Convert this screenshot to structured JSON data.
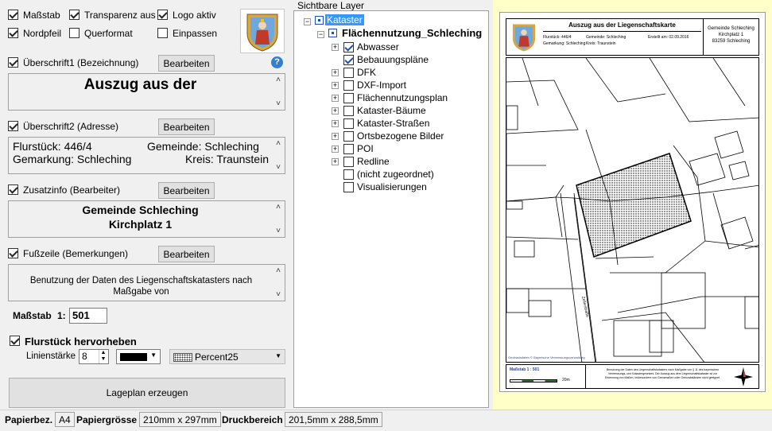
{
  "options": {
    "massstab": {
      "label": "Maßstab",
      "checked": true
    },
    "transparenz": {
      "label": "Transparenz aus",
      "checked": true
    },
    "logo": {
      "label": "Logo aktiv",
      "checked": true
    },
    "nordpfeil": {
      "label": "Nordpfeil",
      "checked": true
    },
    "querformat": {
      "label": "Querformat",
      "checked": false
    },
    "einpassen": {
      "label": "Einpassen",
      "checked": false
    }
  },
  "sections": {
    "ueberschrift1": {
      "label": "Überschrift1 (Bezeichnung)",
      "button": "Bearbeiten",
      "text": "Auszug aus der",
      "help": "?"
    },
    "ueberschrift2": {
      "label": "Überschrift2 (Adresse)",
      "button": "Bearbeiten",
      "flurstueck": "Flurstück: 446/4",
      "gemeinde": "Gemeinde: Schleching",
      "gemarkung": "Gemarkung: Schleching",
      "kreis": "Kreis: Traunstein"
    },
    "zusatzinfo": {
      "label": "Zusatzinfo (Bearbeiter)",
      "button": "Bearbeiten",
      "line1": "Gemeinde Schleching",
      "line2": "Kirchplatz 1"
    },
    "fusszeile": {
      "label": "Fußzeile (Bemerkungen)",
      "button": "Bearbeiten",
      "text": "Benutzung der Daten des Liegenschaftskatasters nach Maßgabe von"
    }
  },
  "scale": {
    "label": "Maßstab",
    "prefix": "1:",
    "value": "501"
  },
  "flurstueck": {
    "label": "Flurstück hervorheben",
    "checked": true,
    "linienstaerke_label": "Linienstärke",
    "linienstaerke_value": "8",
    "color": "#000000",
    "pattern": "Percent25"
  },
  "generate_button": "Lageplan erzeugen",
  "layers": {
    "title": "Sichtbare Layer",
    "root": "Kataster",
    "group": "Flächennutzung_Schleching",
    "items": [
      {
        "label": "Abwasser",
        "checked": true,
        "expand": true
      },
      {
        "label": "Bebauungspläne",
        "checked": true,
        "expand": false
      },
      {
        "label": "DFK",
        "checked": false,
        "expand": true
      },
      {
        "label": "DXF-Import",
        "checked": false,
        "expand": true
      },
      {
        "label": "Flächennutzungsplan",
        "checked": false,
        "expand": true
      },
      {
        "label": "Kataster-Bäume",
        "checked": false,
        "expand": true
      },
      {
        "label": "Kataster-Straßen",
        "checked": false,
        "expand": true
      },
      {
        "label": "Ortsbezogene Bilder",
        "checked": false,
        "expand": true
      },
      {
        "label": "POI",
        "checked": false,
        "expand": true
      },
      {
        "label": "Redline",
        "checked": false,
        "expand": true
      },
      {
        "label": "(nicht zugeordnet)",
        "checked": false,
        "expand": false
      },
      {
        "label": "Visualisierungen",
        "checked": false,
        "expand": false
      }
    ]
  },
  "preview": {
    "title": "Auszug aus der Liegenschaftskarte",
    "flurstueck": "Flurstück: 446/4",
    "gemeinde": "Gemeinde: Schleching",
    "erstellt": "Erstellt am: 02.09.2016",
    "gemarkung": "Gemarkung: Schleching",
    "kreis": "Kreis: Traunstein",
    "addr1": "Gemeinde Schleching",
    "addr2": "Kirchplatz 1",
    "addr3": "83259 Schleching",
    "massstab": "Maßstab 1 : 501",
    "scalebar_label": "20m",
    "footer": "Benutzung der Daten des Liegenschaftskatasters nach Maßgabe von § 11 des bayerischen Vermessungs- und Katastergesetzes. Der Auszug aus dem Liegenschaftskataster ist zur Erkennung von Maßen, insbesondere von Grenzmaßen oder Grenzabständen nicht geeignet.",
    "copyright": "Geobasisdaten © Bayerische Vermessungsverwaltung",
    "street": "Zellerstraße",
    "north": "N"
  },
  "status": {
    "papierbez_label": "Papierbez.",
    "papierbez_value": "A4",
    "papiergroesse_label": "Papiergrösse",
    "papiergroesse_value": "210mm x 297mm",
    "druckbereich_label": "Druckbereich",
    "druckbereich_value": "201,5mm x 288,5mm"
  },
  "colors": {
    "preview_bg": "#ffffc8",
    "selection": "#3399ff",
    "help_blue": "#2f7fd6"
  }
}
